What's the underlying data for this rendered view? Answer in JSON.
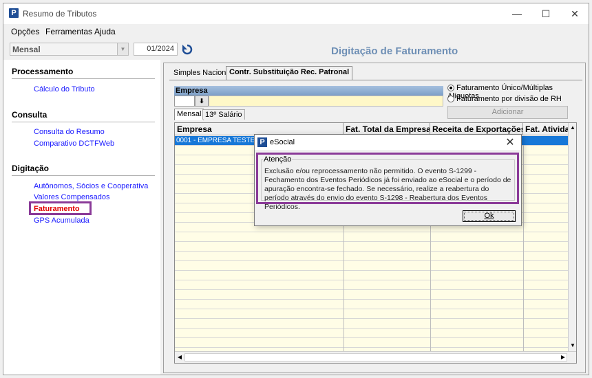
{
  "window": {
    "title": "Resumo de Tributos",
    "controls": {
      "minimize": "—",
      "maximize": "☐",
      "close": "✕"
    }
  },
  "app_icon_letter": "P",
  "menu": {
    "items": [
      "Opções",
      "Ferramentas",
      "Ajuda"
    ]
  },
  "toolbar": {
    "period_type": "Mensal",
    "period": "01/2024"
  },
  "page_heading": "Digitação de Faturamento",
  "sidebar": {
    "sections": [
      {
        "title": "Processamento",
        "items": [
          "Cálculo do Tributo"
        ]
      },
      {
        "title": "Consulta",
        "items": [
          "Consulta do Resumo",
          "Comparativo DCTFWeb"
        ]
      },
      {
        "title": "Digitação",
        "items": [
          "Autônomos, Sócios e Cooperativa",
          "Valores Compensados",
          "Faturamento",
          "GPS Acumulada"
        ]
      }
    ],
    "active_item": "Faturamento"
  },
  "tabs": [
    "Simples Nacional",
    "Contr. Substituição Rec. Patronal"
  ],
  "empresa": {
    "label": "Empresa",
    "lookup_icon": "⬇"
  },
  "options": {
    "radio_1": "Faturamento Único/Múltiplas Alíquotas",
    "radio_2": "Faturamento por divisão de RH",
    "selected": 1,
    "add_button": "Adicionar"
  },
  "subtabs": [
    "Mensal",
    "13º Salário"
  ],
  "grid": {
    "columns": [
      "Empresa",
      "Fat. Total da Empresa",
      "Receita de Exportações",
      "Fat. Ativida"
    ],
    "rows": [
      [
        "0001 - EMPRESA TESTE",
        "",
        "",
        ""
      ]
    ]
  },
  "dialog": {
    "title": "eSocial",
    "close": "✕",
    "group_label": "Atenção",
    "message": "Exclusão e/ou reprocessamento não permitido. O evento S-1299 - Fechamento dos Eventos Periódicos já foi enviado ao eSocial e o período de apuração encontra-se fechado. Se necessário, realize a reabertura do período através do envio do evento S-1298 - Reabertura dos Eventos Periódicos.",
    "ok_label": "Ok"
  },
  "colors": {
    "highlight": "#8a3a98",
    "selection": "#1778d8",
    "link": "#1a1aff",
    "active_link": "#e00000",
    "heading": "#6e8fb5"
  },
  "icons": [
    "app-logo-icon",
    "refresh-icon",
    "chevron-down-icon",
    "download-arrow-icon",
    "close-icon",
    "scroll-up-icon",
    "scroll-down-icon",
    "scroll-left-icon",
    "scroll-right-icon"
  ]
}
